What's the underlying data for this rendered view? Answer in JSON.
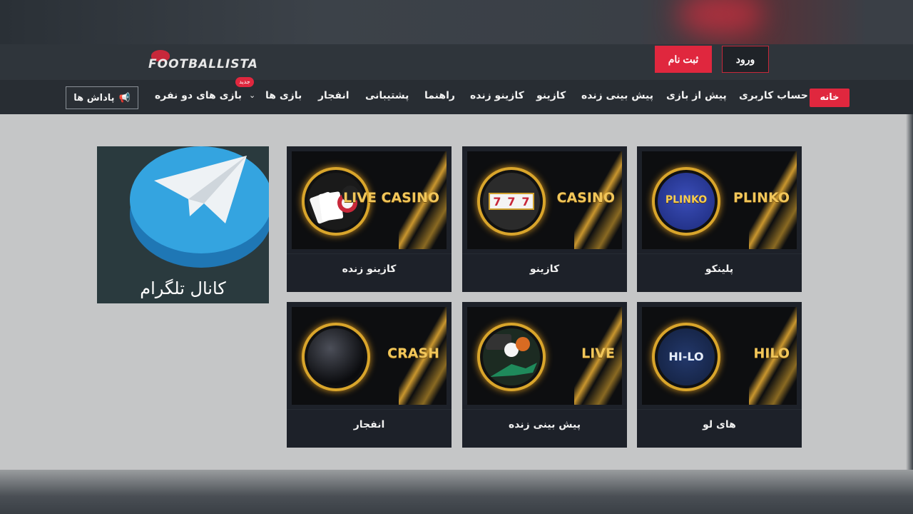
{
  "header": {
    "logo_text": "FOOTBALLISTA",
    "register_label": "ثبت نام",
    "login_label": "ورود"
  },
  "nav": {
    "home": "خانه",
    "items": [
      "حساب کاربری",
      "پیش از بازی",
      "پیش بینی زنده",
      "کازینو",
      "کازینو زنده",
      "راهنما",
      "پشتیبانی",
      "انفجار",
      "بازی ها",
      "بازی های دو نفره"
    ],
    "new_badge": "جدید",
    "rewards": "پاداش ها"
  },
  "telegram": {
    "caption": "کانال تلگرام"
  },
  "games": [
    {
      "label": "پلینکو",
      "banner": "PLINKO",
      "icon_text": "PLINKO"
    },
    {
      "label": "کازینو",
      "banner": "CASINO",
      "icon_text": "777"
    },
    {
      "label": "کازینو زنده",
      "banner": "LIVE CASINO",
      "icon_text": ""
    },
    {
      "label": "های لو",
      "banner": "HILO",
      "icon_text": "HI-LO"
    },
    {
      "label": "پیش بینی زنده",
      "banner": "LIVE",
      "icon_text": ""
    },
    {
      "label": "انفجار",
      "banner": "CRASH",
      "icon_text": ""
    }
  ],
  "colors": {
    "accent": "#e0273e",
    "header_bg": "#2c3238",
    "content_bg": "#c5c6c7",
    "card_bg": "#1d2129",
    "gold": "#f1c65a"
  }
}
